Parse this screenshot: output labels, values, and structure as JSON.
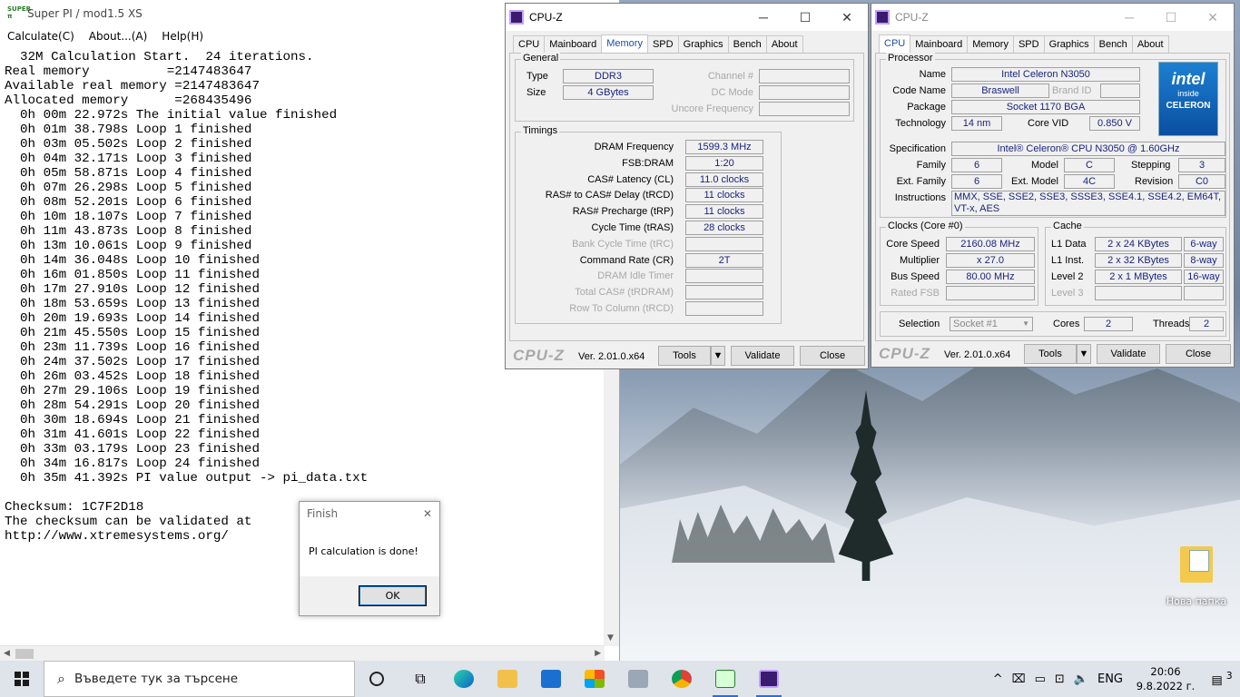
{
  "superpi": {
    "title": "Super PI / mod1.5 XS",
    "logo_text": "SUPER π",
    "menu": [
      "Calculate(C)",
      "About...(A)",
      "Help(H)"
    ],
    "output": "  32M Calculation Start.  24 iterations.\nReal memory          =2147483647\nAvailable real memory =2147483647\nAllocated memory      =268435496\n  0h 00m 22.972s The initial value finished\n  0h 01m 38.798s Loop 1 finished\n  0h 03m 05.502s Loop 2 finished\n  0h 04m 32.171s Loop 3 finished\n  0h 05m 58.871s Loop 4 finished\n  0h 07m 26.298s Loop 5 finished\n  0h 08m 52.201s Loop 6 finished\n  0h 10m 18.107s Loop 7 finished\n  0h 11m 43.873s Loop 8 finished\n  0h 13m 10.061s Loop 9 finished\n  0h 14m 36.048s Loop 10 finished\n  0h 16m 01.850s Loop 11 finished\n  0h 17m 27.910s Loop 12 finished\n  0h 18m 53.659s Loop 13 finished\n  0h 20m 19.693s Loop 14 finished\n  0h 21m 45.550s Loop 15 finished\n  0h 23m 11.739s Loop 16 finished\n  0h 24m 37.502s Loop 17 finished\n  0h 26m 03.452s Loop 18 finished\n  0h 27m 29.106s Loop 19 finished\n  0h 28m 54.291s Loop 20 finished\n  0h 30m 18.694s Loop 21 finished\n  0h 31m 41.601s Loop 22 finished\n  0h 33m 03.179s Loop 23 finished\n  0h 34m 16.817s Loop 24 finished\n  0h 35m 41.392s PI value output -> pi_data.txt\n\nChecksum: 1C7F2D18\nThe checksum can be validated at\nhttp://www.xtremesystems.org/"
  },
  "dialog": {
    "title": "Finish",
    "message": "PI calculation is done!",
    "ok": "OK",
    "close_glyph": "✕"
  },
  "cpuz_mem": {
    "title": "CPU-Z",
    "tabs": [
      "CPU",
      "Mainboard",
      "Memory",
      "SPD",
      "Graphics",
      "Bench",
      "About"
    ],
    "selected_tab": "Memory",
    "general_legend": "General",
    "type_label": "Type",
    "type": "DDR3",
    "size_label": "Size",
    "size": "4 GBytes",
    "channel_label": "Channel #",
    "dcmode_label": "DC Mode",
    "uncore_label": "Uncore Frequency",
    "timings_legend": "Timings",
    "timings": [
      {
        "label": "DRAM Frequency",
        "value": "1599.3 MHz",
        "dim": false
      },
      {
        "label": "FSB:DRAM",
        "value": "1:20",
        "dim": false
      },
      {
        "label": "CAS# Latency (CL)",
        "value": "11.0 clocks",
        "dim": false
      },
      {
        "label": "RAS# to CAS# Delay (tRCD)",
        "value": "11 clocks",
        "dim": false
      },
      {
        "label": "RAS# Precharge (tRP)",
        "value": "11 clocks",
        "dim": false
      },
      {
        "label": "Cycle Time (tRAS)",
        "value": "28 clocks",
        "dim": false
      },
      {
        "label": "Bank Cycle Time (tRC)",
        "value": "",
        "dim": true
      },
      {
        "label": "Command Rate (CR)",
        "value": "2T",
        "dim": false
      },
      {
        "label": "DRAM Idle Timer",
        "value": "",
        "dim": true
      },
      {
        "label": "Total CAS# (tRDRAM)",
        "value": "",
        "dim": true
      },
      {
        "label": "Row To Column (tRCD)",
        "value": "",
        "dim": true
      }
    ],
    "brand": "CPU-Z",
    "version": "Ver. 2.01.0.x64",
    "tools": "Tools",
    "validate": "Validate",
    "close": "Close"
  },
  "cpuz_cpu": {
    "title": "CPU-Z",
    "tabs": [
      "CPU",
      "Mainboard",
      "Memory",
      "SPD",
      "Graphics",
      "Bench",
      "About"
    ],
    "selected_tab": "CPU",
    "processor_legend": "Processor",
    "name_label": "Name",
    "name": "Intel Celeron N3050",
    "codename_label": "Code Name",
    "codename": "Braswell",
    "brandid_label": "Brand ID",
    "package_label": "Package",
    "package": "Socket 1170 BGA",
    "tech_label": "Technology",
    "tech": "14 nm",
    "corevid_label": "Core VID",
    "corevid": "0.850 V",
    "spec_label": "Specification",
    "spec": "Intel® Celeron® CPU  N3050  @ 1.60GHz",
    "family_label": "Family",
    "family": "6",
    "model_label": "Model",
    "model": "C",
    "stepping_label": "Stepping",
    "stepping": "3",
    "extfamily_label": "Ext. Family",
    "extfamily": "6",
    "extmodel_label": "Ext. Model",
    "extmodel": "4C",
    "revision_label": "Revision",
    "revision": "C0",
    "instr_label": "Instructions",
    "instr": "MMX, SSE, SSE2, SSE3, SSSE3, SSE4.1, SSE4.2, EM64T, VT-x, AES",
    "intel_logo": {
      "brand": "intel",
      "sub": "inside",
      "product": "CELERON"
    },
    "clocks_legend": "Clocks (Core #0)",
    "corespeed_label": "Core Speed",
    "corespeed": "2160.08 MHz",
    "multiplier_label": "Multiplier",
    "multiplier": "x 27.0",
    "busspeed_label": "Bus Speed",
    "busspeed": "80.00 MHz",
    "ratedfsb_label": "Rated FSB",
    "cache_legend": "Cache",
    "l1d_label": "L1 Data",
    "l1d": "2 x 24 KBytes",
    "l1d_way": "6-way",
    "l1i_label": "L1 Inst.",
    "l1i": "2 x 32 KBytes",
    "l1i_way": "8-way",
    "l2_label": "Level 2",
    "l2": "2 x 1 MBytes",
    "l2_way": "16-way",
    "l3_label": "Level 3",
    "selection_label": "Selection",
    "selection": "Socket #1",
    "cores_label": "Cores",
    "cores": "2",
    "threads_label": "Threads",
    "threads": "2",
    "brand": "CPU-Z",
    "version": "Ver. 2.01.0.x64",
    "tools": "Tools",
    "validate": "Validate",
    "close": "Close"
  },
  "desktop": {
    "folder_label": "Нова папка"
  },
  "taskbar": {
    "search_placeholder": "Въведете тук за търсене",
    "lang": "ENG",
    "time": "20:06",
    "date": "9.8.2022 г.",
    "notif_count": "3",
    "accent": "#2b6fd6"
  }
}
